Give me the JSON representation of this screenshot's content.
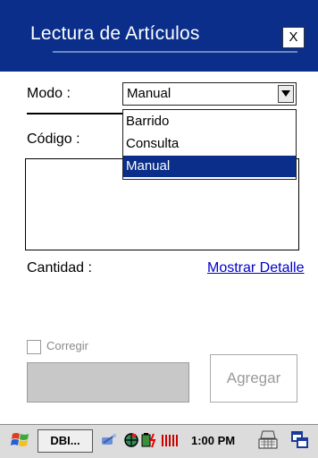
{
  "app": {
    "title": "Lectura de Artículos",
    "close_label": "X"
  },
  "form": {
    "modo_label": "Modo :",
    "modo_selected": "Manual",
    "modo_options": [
      "Barrido",
      "Consulta",
      "Manual"
    ],
    "codigo_label": "Código :",
    "cantidad_label": "Cantidad :",
    "mostrar_detalle_link": "Mostrar Detalle",
    "corregir_label": "Corregir",
    "corregir_checked": false,
    "agregar_label": "Agregar"
  },
  "taskbar": {
    "app_button": "DBI...",
    "clock": "1:00 PM",
    "icons": [
      "windows-start-icon",
      "network-icon",
      "globe-icon",
      "battery-icon",
      "signal-icon",
      "keyboard-icon",
      "task-switch-icon"
    ]
  },
  "colors": {
    "header_bg": "#0a2e8a",
    "selection_bg": "#0a2e8a",
    "link": "#0000cc"
  }
}
